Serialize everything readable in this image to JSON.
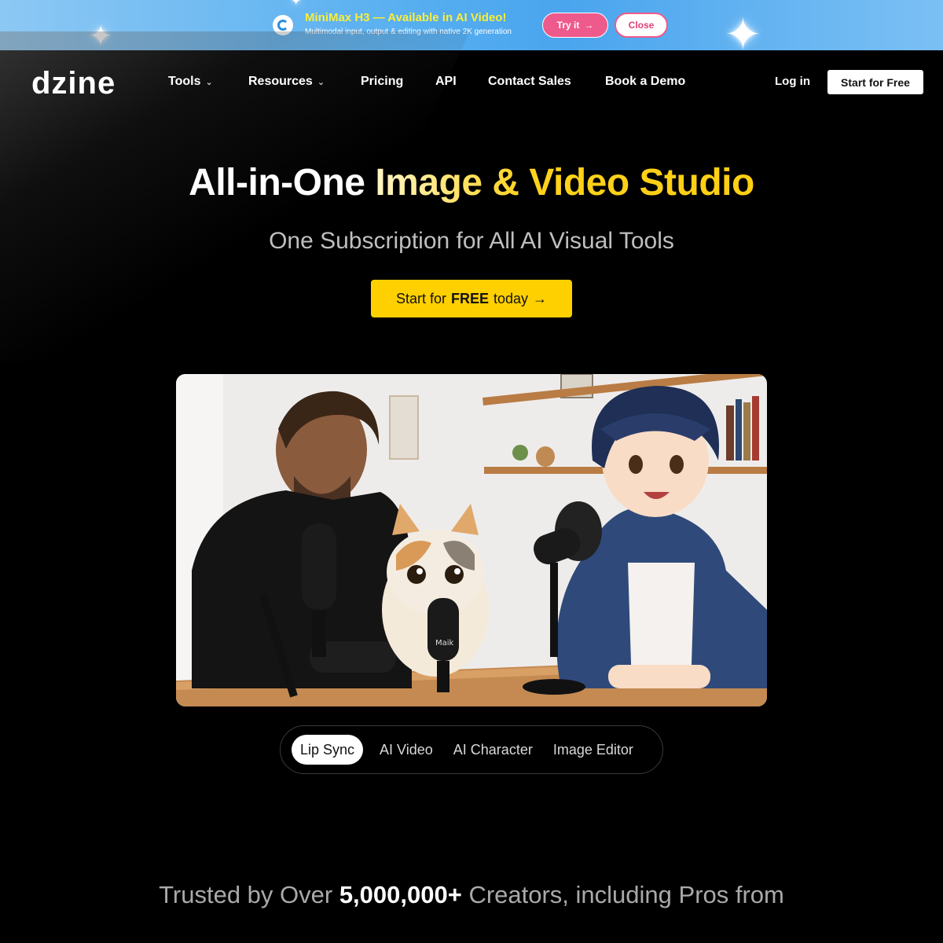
{
  "promo": {
    "title": "MiniMax H3 — Available in AI Video!",
    "subtitle": "Multimodal input, output & editing with native 2K generation",
    "try_label": "Try it",
    "try_arrow": "→",
    "close_label": "Close"
  },
  "nav": {
    "logo": "dzine",
    "items": [
      {
        "label": "Tools",
        "dropdown": true
      },
      {
        "label": "Resources",
        "dropdown": true
      },
      {
        "label": "Pricing",
        "dropdown": false
      },
      {
        "label": "API",
        "dropdown": false
      },
      {
        "label": "Contact Sales",
        "dropdown": false
      },
      {
        "label": "Book a Demo",
        "dropdown": false
      }
    ],
    "chevron": "⌄",
    "login_label": "Log in",
    "start_label": "Start for Free"
  },
  "hero": {
    "title_part1": "All-in-One ",
    "title_part2": "Image & Video Studio",
    "subtitle": "One Subscription for All AI Visual Tools",
    "cta_prefix": "Start for",
    "cta_bold": "FREE",
    "cta_suffix": "today",
    "cta_arrow": "→"
  },
  "showcase": {
    "mic_brand": "Maik"
  },
  "tabs": {
    "items": [
      "Lip Sync",
      "AI Video",
      "AI Character",
      "Image Editor"
    ],
    "active_index": 0
  },
  "trusted": {
    "prefix": "Trusted by Over ",
    "count": "5,000,000+",
    "suffix": " Creators, including Pros from"
  },
  "colors": {
    "accent_yellow": "#ffd000",
    "banner_blue": "#56aef0",
    "banner_pink": "#ef5a8c"
  }
}
